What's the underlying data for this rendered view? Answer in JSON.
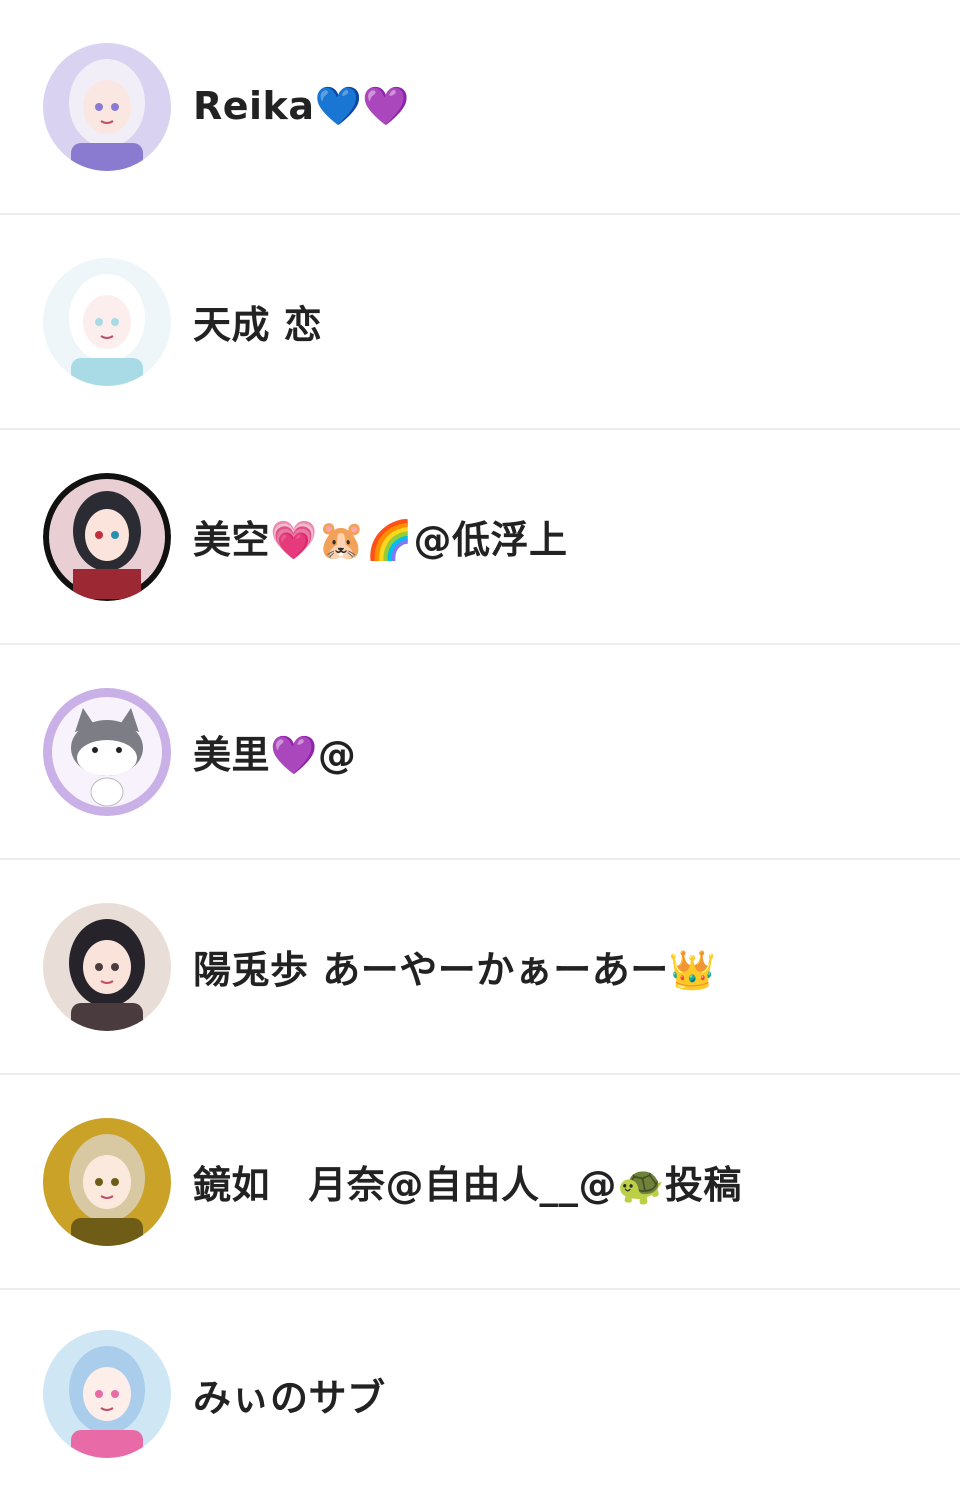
{
  "followers": [
    {
      "name": "Reika💙💜",
      "avatar": "anime-girl-silver-hair-avatar",
      "colors": {
        "bg": "#d9d2f0",
        "hair": "#f2eef8",
        "accent": "#8a7ad0",
        "skin": "#fbe7e2"
      }
    },
    {
      "name": "天成 恋",
      "avatar": "anime-girl-sketch-avatar",
      "colors": {
        "bg": "#eef6f9",
        "hair": "#ffffff",
        "accent": "#a8dbe6",
        "skin": "#fdeeee"
      }
    },
    {
      "name": "美空💗🐹🌈@低浮上",
      "avatar": "anime-girl-dark-hair-avatar",
      "colors": {
        "bg": "#e9cfd3",
        "hair": "#2b2b33",
        "accent": "#9b2833",
        "skin": "#fbe4dc"
      }
    },
    {
      "name": "美里💜@",
      "avatar": "cat-illustration-avatar",
      "colors": {
        "bg": "#c9b0e6",
        "hair": "#ffffff",
        "accent": "#7d7d86",
        "skin": "#f4f4f4"
      }
    },
    {
      "name": "陽兎歩 あーやーかぁーあー👑",
      "avatar": "anime-girl-glasses-avatar",
      "colors": {
        "bg": "#e9ddd8",
        "hair": "#27232a",
        "accent": "#4a3c3e",
        "skin": "#fae3da"
      }
    },
    {
      "name": "鏡如　月奈@自由人__@🐢投稿",
      "avatar": "anime-girl-blonde-sparkle-avatar",
      "colors": {
        "bg": "#c9a227",
        "hair": "#d8c9a2",
        "accent": "#6f5c16",
        "skin": "#fbe9dd"
      }
    },
    {
      "name": "みぃのサブ",
      "avatar": "anime-girl-blue-hair-tour-avatar",
      "colors": {
        "bg": "#cfe6f5",
        "hair": "#a9cdea",
        "accent": "#e86aa6",
        "skin": "#fdeeea"
      }
    }
  ]
}
